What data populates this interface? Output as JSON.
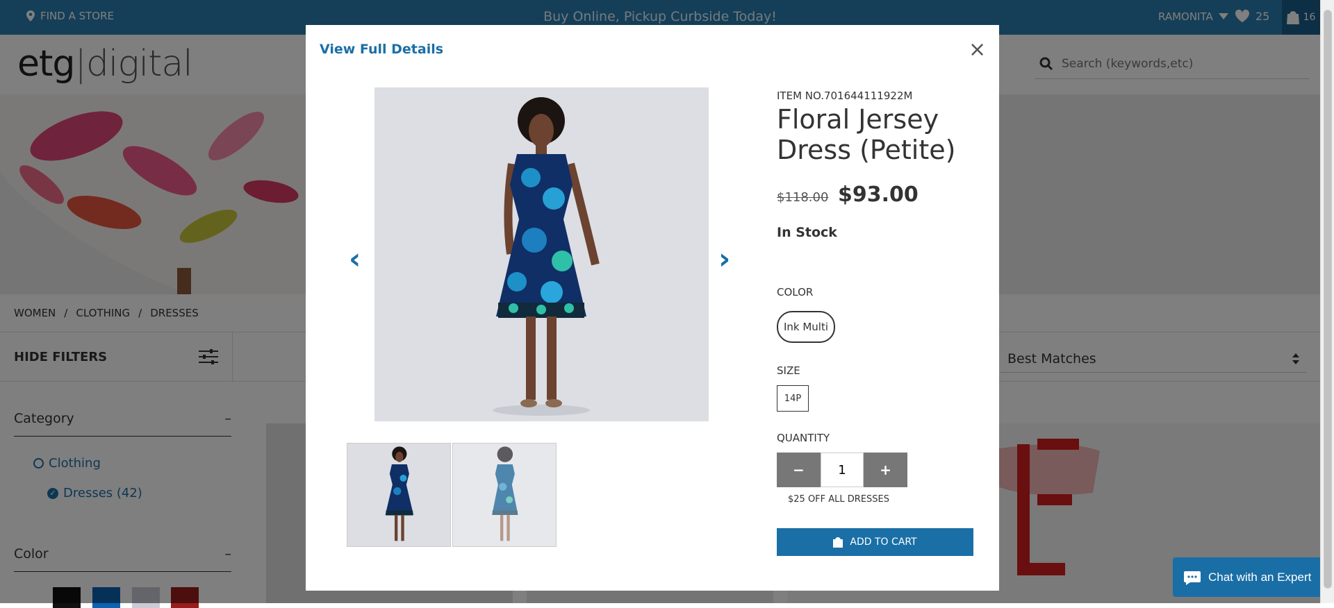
{
  "topbar": {
    "find_store": "FIND A STORE",
    "promo": "Buy Online, Pickup Curbside Today!",
    "user": "RAMONITA",
    "wishlist_count": "25",
    "cart_count": "16"
  },
  "header": {
    "logo_etg": "etg",
    "logo_digital": "digital",
    "search_placeholder": "Search (keywords,etc)"
  },
  "breadcrumb": [
    "WOMEN",
    "CLOTHING",
    "DRESSES"
  ],
  "filters": {
    "label": "HIDE FILTERS"
  },
  "sort": {
    "selected": "Best Matches"
  },
  "sidebar": {
    "category_title": "Category",
    "clothing": "Clothing",
    "dresses": "Dresses (42)",
    "color_title": "Color",
    "swatches": [
      "#111111",
      "#0a63b3",
      "#c9cbd6",
      "#9b1c1c"
    ]
  },
  "modal": {
    "view_full_details": "View Full Details",
    "item_no": "ITEM NO.701644111922M",
    "title": "Floral Jersey Dress (Petite)",
    "price_old": "$118.00",
    "price_new": "$93.00",
    "stock": "In Stock",
    "color_label": "COLOR",
    "color_value": "Ink Multi",
    "size_label": "SIZE",
    "size_value": "14P",
    "quantity_label": "QUANTITY",
    "quantity_value": "1",
    "promo_note": "$25 OFF ALL DRESSES",
    "add_to_cart": "ADD TO CART"
  },
  "chat": {
    "label": "Chat with an Expert"
  },
  "colors": {
    "brand_blue": "#1a6fa6",
    "topbar": "#2a7fb1"
  }
}
